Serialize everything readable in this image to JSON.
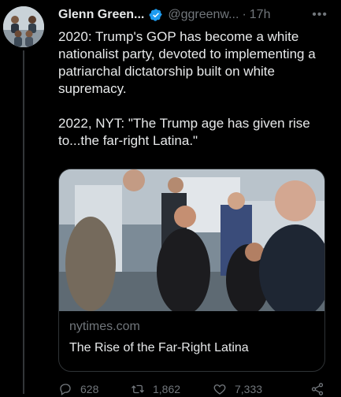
{
  "tweet": {
    "author_name": "Glenn Green...",
    "handle": "@ggreenw...",
    "separator": "·",
    "time": "17h",
    "more_label": "•••",
    "text": "2020: Trump's GOP has become a white nationalist party, devoted to implementing a patriarchal dictatorship built on white supremacy.\n\n2022, NYT: \"The Trump age has given rise to...the far-right Latina.\""
  },
  "card": {
    "domain": "nytimes.com",
    "title": "The Rise of the Far-Right Latina"
  },
  "actions": {
    "replies": "628",
    "retweets": "1,862",
    "likes": "7,333"
  },
  "colors": {
    "background": "#000000",
    "text_primary": "#e7e9ea",
    "text_secondary": "#71767b",
    "border": "#2f3336",
    "verified": "#1d9bf0"
  },
  "icons": [
    "verified-badge-icon",
    "more-icon",
    "reply-icon",
    "retweet-icon",
    "like-icon",
    "share-icon"
  ]
}
